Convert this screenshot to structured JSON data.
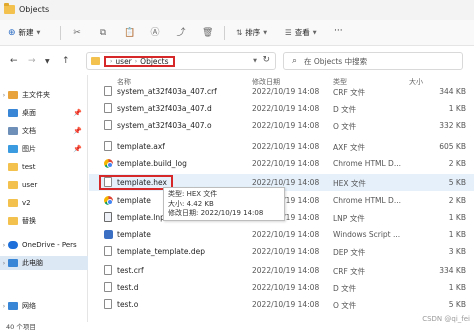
{
  "window": {
    "title": "Objects"
  },
  "toolbar": {
    "new_label": "新建",
    "sort_label": "排序",
    "view_label": "查看",
    "more_label": "···"
  },
  "address": {
    "crumbs": [
      "user",
      "Objects"
    ]
  },
  "search": {
    "placeholder": "在 Objects 中搜索"
  },
  "sidebar": {
    "items": [
      {
        "label": "主文件夹",
        "icon": "home-icon",
        "color": "#e8a33d"
      },
      {
        "label": "桌面",
        "icon": "desktop-icon",
        "color": "#3a86d6"
      },
      {
        "label": "文档",
        "icon": "documents-icon",
        "color": "#6d8fb8"
      },
      {
        "label": "图片",
        "icon": "pictures-icon",
        "color": "#3b9be0"
      },
      {
        "label": "test",
        "icon": "folder-icon",
        "color": "#f2c14e"
      },
      {
        "label": "user",
        "icon": "folder-icon",
        "color": "#f2c14e"
      },
      {
        "label": "v2",
        "icon": "folder-icon",
        "color": "#f2c14e"
      },
      {
        "label": "替换",
        "icon": "folder-icon",
        "color": "#f2c14e"
      },
      {
        "label": "OneDrive - Pers",
        "icon": "cloud-icon",
        "color": "#1e6fd9"
      },
      {
        "label": "此电脑",
        "icon": "computer-icon",
        "color": "#3a86d6"
      },
      {
        "label": "网络",
        "icon": "network-icon",
        "color": "#3a86d6"
      }
    ]
  },
  "columns": {
    "name": "名称",
    "date": "修改日期",
    "type": "类型",
    "size": "大小"
  },
  "files": [
    {
      "name": "system_at32f403a_407.crf",
      "date": "2022/10/19 14:08",
      "type": "CRF 文件",
      "size": "344 KB",
      "icon": "file-icon"
    },
    {
      "name": "system_at32f403a_407.d",
      "date": "2022/10/19 14:08",
      "type": "D 文件",
      "size": "1 KB",
      "icon": "file-icon"
    },
    {
      "name": "system_at32f403a_407.o",
      "date": "2022/10/19 14:08",
      "type": "O 文件",
      "size": "332 KB",
      "icon": "file-icon"
    },
    {
      "name": "template.axf",
      "date": "2022/10/19 14:08",
      "type": "AXF 文件",
      "size": "605 KB",
      "icon": "file-icon"
    },
    {
      "name": "template.build_log",
      "date": "2022/10/19 14:08",
      "type": "Chrome HTML D...",
      "size": "2 KB",
      "icon": "chrome-icon"
    },
    {
      "name": "template.hex",
      "date": "2022/10/19 14:08",
      "type": "HEX 文件",
      "size": "5 KB",
      "icon": "file-icon"
    },
    {
      "name": "template",
      "date": "2022/10/19 14:08",
      "type": "Chrome HTML D...",
      "size": "2 KB",
      "icon": "chrome-icon"
    },
    {
      "name": "template.lnp",
      "date": "2022/10/19 14:08",
      "type": "LNP 文件",
      "size": "1 KB",
      "icon": "lnp-file-icon"
    },
    {
      "name": "template",
      "date": "2022/10/19 14:08",
      "type": "Windows Script ...",
      "size": "1 KB",
      "icon": "script-icon"
    },
    {
      "name": "template_template.dep",
      "date": "2022/10/19 14:08",
      "type": "DEP 文件",
      "size": "3 KB",
      "icon": "file-icon"
    },
    {
      "name": "test.crf",
      "date": "2022/10/19 14:08",
      "type": "CRF 文件",
      "size": "334 KB",
      "icon": "file-icon"
    },
    {
      "name": "test.d",
      "date": "2022/10/19 14:08",
      "type": "D 文件",
      "size": "1 KB",
      "icon": "file-icon"
    },
    {
      "name": "test.o",
      "date": "2022/10/19 14:08",
      "type": "O 文件",
      "size": "5 KB",
      "icon": "file-icon"
    }
  ],
  "tooltip": {
    "line1": "类型: HEX 文件",
    "line2": "大小: 4.42 KB",
    "line3": "修改日期: 2022/10/19 14:08"
  },
  "status": {
    "count": "40 个项目"
  },
  "watermark": "CSDN @qi_fei",
  "colors": {
    "highlight": "#d62828",
    "selection": "#e5f0fb",
    "sidebar_selected": "#dde8f5"
  }
}
